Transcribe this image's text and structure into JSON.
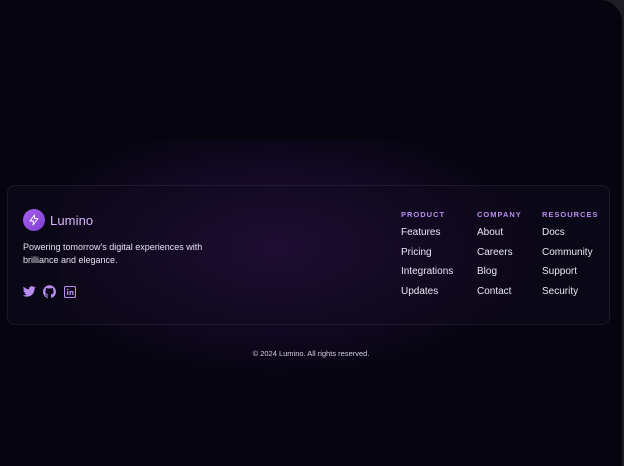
{
  "brand": {
    "name": "Lumino",
    "tagline": "Powering tomorrow's digital experiences with brilliance and elegance.",
    "logo_icon": "sparkle-icon",
    "accent": "#a95ff0"
  },
  "socials": [
    {
      "icon": "twitter-icon"
    },
    {
      "icon": "github-icon"
    },
    {
      "icon": "linkedin-icon"
    }
  ],
  "columns": [
    {
      "heading": "PRODUCT",
      "links": [
        "Features",
        "Pricing",
        "Integrations",
        "Updates"
      ]
    },
    {
      "heading": "COMPANY",
      "links": [
        "About",
        "Careers",
        "Blog",
        "Contact"
      ]
    },
    {
      "heading": "RESOURCES",
      "links": [
        "Docs",
        "Community",
        "Support",
        "Security"
      ]
    }
  ],
  "copyright": "© 2024 Lumino. All rights reserved.",
  "colors": {
    "background": "#05040f",
    "heading": "#b98df0",
    "text": "#ece8f5",
    "icon": "#b98df0"
  }
}
